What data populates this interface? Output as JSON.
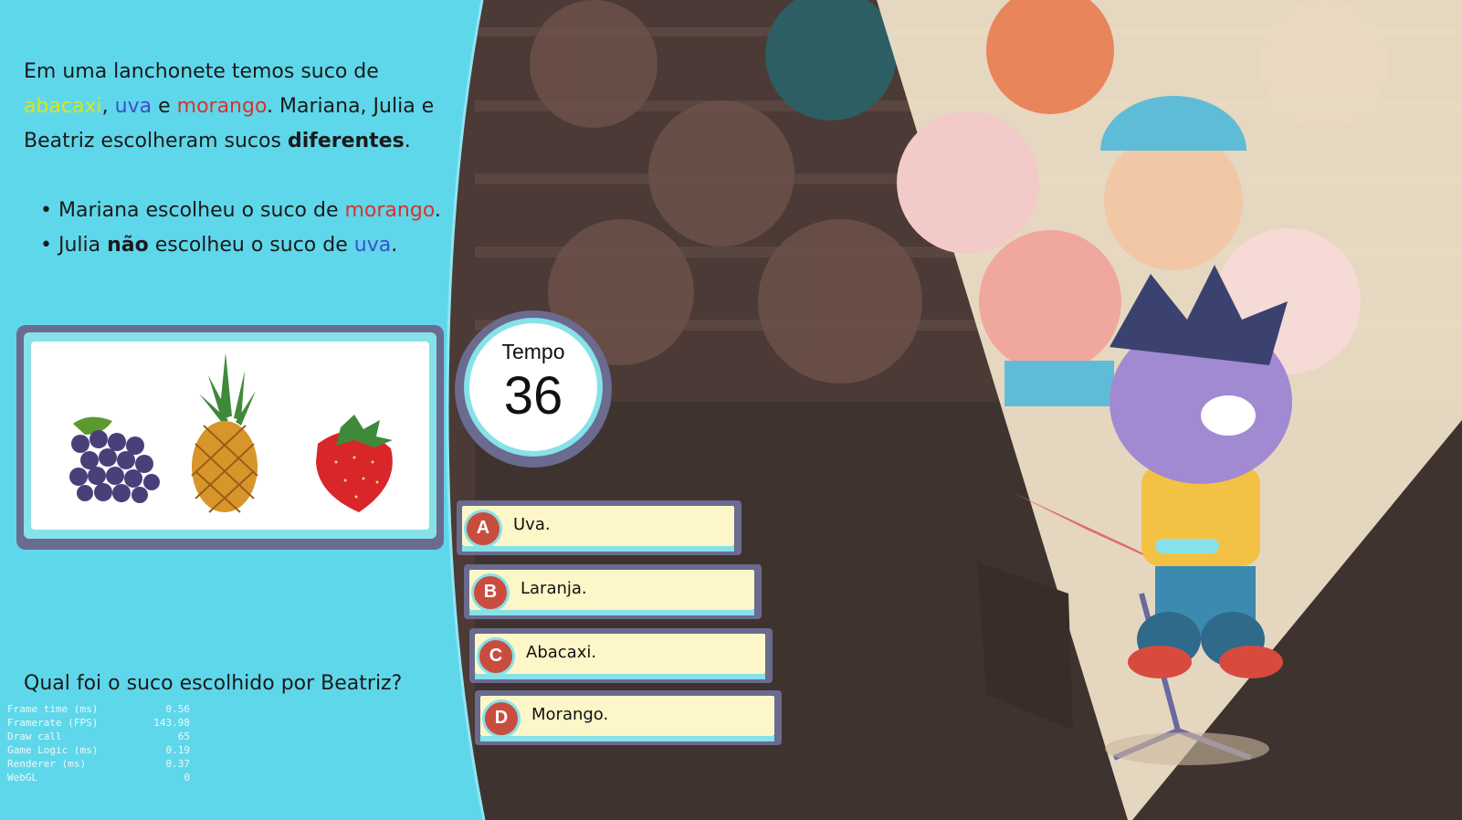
{
  "question": {
    "intro_line1": "Em uma lanchonete temos suco de",
    "fruit_abacaxi": "abacaxi",
    "comma": ",",
    "fruit_uva": "uva",
    "and": "e",
    "fruit_morango": "morango",
    "intro_rest": ". Mariana, Julia e Beatriz escolheram sucos",
    "diferentes": "diferentes",
    "period": ".",
    "bullet1_pre": "Mariana escolheu o suco de",
    "bullet1_fruit": "morango",
    "bullet2_pre": "Julia",
    "bullet2_nao": "não",
    "bullet2_mid": "escolheu o suco de",
    "bullet2_fruit": "uva",
    "final": "Qual foi o suco escolhido por Beatriz?"
  },
  "timer": {
    "label": "Tempo",
    "value": "36"
  },
  "answers": [
    {
      "letter": "A",
      "text": "Uva."
    },
    {
      "letter": "B",
      "text": "Laranja."
    },
    {
      "letter": "C",
      "text": "Abacaxi."
    },
    {
      "letter": "D",
      "text": "Morango."
    }
  ],
  "debug": [
    {
      "name": "Frame time (ms)",
      "value": "0.56"
    },
    {
      "name": "Framerate (FPS)",
      "value": "143.98"
    },
    {
      "name": "Draw call",
      "value": "65"
    },
    {
      "name": "Game Logic (ms)",
      "value": "0.19"
    },
    {
      "name": "Renderer (ms)",
      "value": "0.37"
    },
    {
      "name": "WebGL",
      "value": "0"
    }
  ],
  "colors": {
    "panel": "#5fd7ea",
    "abacaxi": "#d9e51a",
    "uva": "#3a4fd0",
    "morango": "#d9322b",
    "badge": "#c94d3f",
    "answer_fill": "#fdf6c8"
  },
  "icons": [
    "grapes-image",
    "pineapple-image",
    "strawberry-image"
  ]
}
